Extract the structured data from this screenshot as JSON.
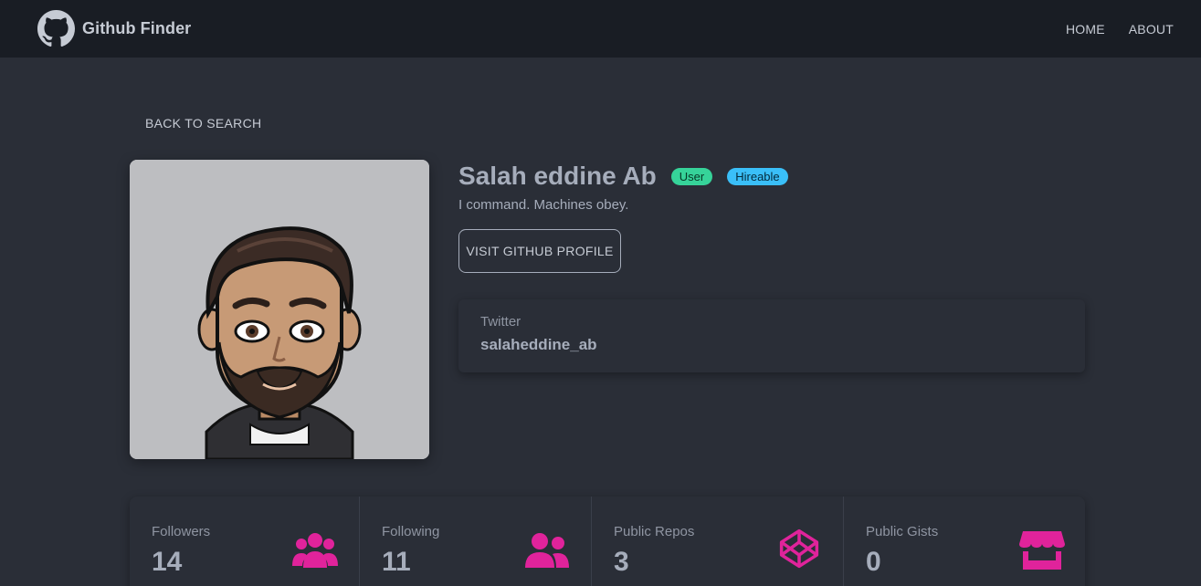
{
  "navbar": {
    "brand": "Github Finder",
    "brand_icon": "github-icon",
    "links": [
      {
        "label": "HOME"
      },
      {
        "label": "ABOUT"
      }
    ]
  },
  "back_link": "BACK TO SEARCH",
  "profile": {
    "name": "Salah eddine Ab",
    "badges": [
      {
        "label": "User",
        "color": "#36d399"
      },
      {
        "label": "Hireable",
        "color": "#3abff8"
      }
    ],
    "bio": "I command. Machines obey.",
    "visit_button": "VISIT GITHUB PROFILE",
    "twitter": {
      "label": "Twitter",
      "value": "salaheddine_ab"
    }
  },
  "stats": [
    {
      "title": "Followers",
      "value": "14",
      "icon": "users-icon"
    },
    {
      "title": "Following",
      "value": "11",
      "icon": "user-friends-icon"
    },
    {
      "title": "Public Repos",
      "value": "3",
      "icon": "codepen-icon"
    },
    {
      "title": "Public Gists",
      "value": "0",
      "icon": "store-icon"
    }
  ],
  "colors": {
    "background": "#2a2e37",
    "navbar": "#191d24",
    "accent_icon": "#e0239b"
  }
}
